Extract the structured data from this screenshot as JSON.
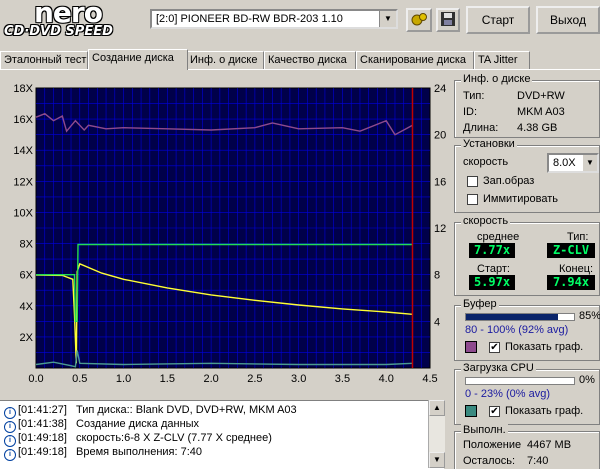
{
  "header": {
    "logo_top": "nero",
    "logo_bottom": "CD·DVD SPEED",
    "drive": "[2:0]   PIONEER BD-RW   BDR-203 1.10",
    "start_label": "Старт",
    "exit_label": "Выход"
  },
  "tabs": [
    "Эталонный тест",
    "Создание диска",
    "Инф. о диске",
    "Качество диска",
    "Сканирование диска",
    "TA Jitter"
  ],
  "active_tab": 1,
  "disc_info": {
    "title": "Инф. о диске",
    "type_label": "Тип:",
    "type_value": "DVD+RW",
    "id_label": "ID:",
    "id_value": "MKM A03",
    "length_label": "Длина:",
    "length_value": "4.38 GB"
  },
  "settings": {
    "title": "Установки",
    "speed_label": "скорость",
    "speed_value": "8.0X",
    "image_label": "Зап.образ",
    "simulate_label": "Иммитировать"
  },
  "speed": {
    "title": "скорость",
    "avg_label": "среднее",
    "avg_value": "7.77x",
    "type_label": "Тип:",
    "type_value": "Z-CLV",
    "start_label": "Старт:",
    "start_value": "5.97x",
    "end_label": "Конец:",
    "end_value": "7.94x"
  },
  "buffer": {
    "title": "Буфер",
    "percent_text": "85%",
    "level": 0.85,
    "range_text": "80 - 100% (92% avg)",
    "color": "#8e4a8e",
    "show_label": "Показать граф."
  },
  "cpu": {
    "title": "Загрузка CPU",
    "percent_text": "0%",
    "level": 0.0,
    "range_text": "0 - 23% (0% avg)",
    "color": "#3a8a80",
    "show_label": "Показать граф."
  },
  "progress": {
    "title": "Выполн.",
    "position_label": "Положение",
    "position_value": "4467 MB",
    "remain_label": "Осталось:",
    "remain_value": "7:40"
  },
  "log": [
    {
      "time": "[01:41:27]",
      "text": "Тип диска:: Blank DVD, DVD+RW, MKM A03"
    },
    {
      "time": "[01:41:38]",
      "text": "Создание диска данных"
    },
    {
      "time": "[01:49:18]",
      "text": "скорость:6-8 X Z-CLV (7.77 X среднее)"
    },
    {
      "time": "[01:49:18]",
      "text": "Время выполнения:  7:40"
    }
  ],
  "chart_data": {
    "type": "line",
    "x_ticks": [
      "0.0",
      "0.5",
      "1.0",
      "1.5",
      "2.0",
      "2.5",
      "3.0",
      "3.5",
      "4.0",
      "4.5"
    ],
    "y_left_ticks": [
      "2X",
      "4X",
      "6X",
      "8X",
      "10X",
      "12X",
      "14X",
      "16X",
      "18X"
    ],
    "y_right_ticks": [
      "4",
      "8",
      "12",
      "16",
      "20",
      "24"
    ],
    "xlim": [
      0,
      4.5
    ],
    "ylim_left": [
      0,
      18
    ],
    "ylim_right": [
      0,
      24
    ],
    "background": "#00004a",
    "grid_color": "#0000dd",
    "series": [
      {
        "color": "#ffff33",
        "axis": "left",
        "x": [
          0.0,
          0.3,
          0.42,
          0.44,
          0.46,
          0.47,
          0.5,
          0.75,
          1.0,
          1.5,
          2.0,
          2.5,
          3.0,
          3.5,
          4.0,
          4.3
        ],
        "y": [
          5.97,
          5.95,
          5.7,
          3.4,
          0.3,
          6.2,
          6.7,
          6.1,
          5.7,
          5.15,
          4.7,
          4.35,
          4.05,
          3.8,
          3.6,
          3.45
        ]
      },
      {
        "color": "#22dd55",
        "axis": "left",
        "x": [
          0.0,
          0.44,
          0.45,
          0.47,
          0.48,
          1.0,
          2.0,
          3.0,
          4.0,
          4.3
        ],
        "y": [
          6.0,
          6.0,
          3.0,
          3.0,
          7.94,
          7.94,
          7.94,
          7.94,
          7.94,
          7.94
        ]
      },
      {
        "color": "#8e4a8e",
        "axis": "right",
        "x": [
          0.0,
          0.1,
          0.2,
          0.3,
          0.35,
          0.45,
          0.55,
          0.6,
          0.8,
          1.0,
          1.5,
          2.0,
          2.5,
          2.7,
          3.0,
          3.5,
          3.7,
          4.0,
          4.1,
          4.3
        ],
        "y": [
          21.5,
          21.8,
          21.2,
          21.6,
          20.3,
          21.2,
          20.4,
          20.8,
          20.5,
          20.6,
          20.5,
          20.4,
          20.6,
          21.0,
          20.5,
          20.6,
          20.3,
          21.2,
          20.0,
          20.8
        ]
      },
      {
        "color": "#4a9a90",
        "axis": "right",
        "x": [
          0.0,
          0.2,
          0.4,
          0.45,
          0.47,
          0.5,
          1.0,
          2.0,
          3.0,
          4.0,
          4.3
        ],
        "y": [
          0.3,
          0.5,
          0.2,
          0.1,
          1.5,
          0.4,
          0.3,
          0.4,
          0.3,
          0.3,
          0.4
        ]
      }
    ],
    "end_marker_x": 4.3,
    "end_marker_color": "#c00000"
  }
}
